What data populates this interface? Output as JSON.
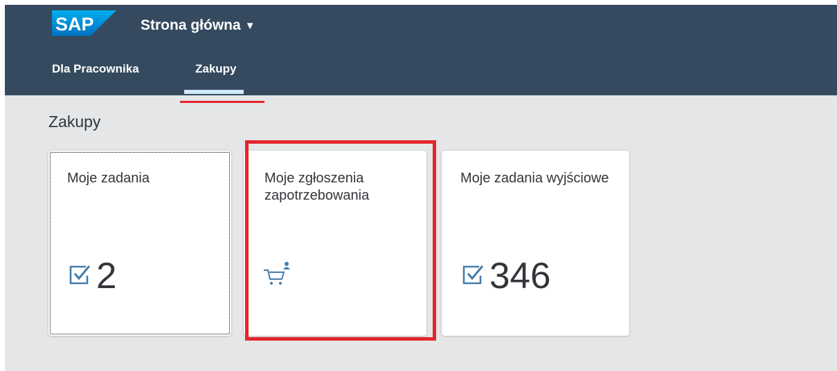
{
  "shell": {
    "logo_text": "SAP",
    "title": "Strona główna",
    "title_caret": "▼"
  },
  "tabs": [
    {
      "label": "Dla Pracownika"
    },
    {
      "label": "Zakupy",
      "selected": true
    }
  ],
  "section": {
    "title": "Zakupy"
  },
  "tiles": [
    {
      "title": "Moje zadania",
      "icon": "task-check-icon",
      "value": "2"
    },
    {
      "title": "Moje zgłoszenia zapotrzebowania",
      "icon": "cart-user-icon"
    },
    {
      "title": "Moje zadania wyjściowe",
      "icon": "task-check-icon",
      "value": "346"
    }
  ],
  "colors": {
    "shell_bg": "#354a5f",
    "page_bg": "#e4e6e7",
    "icon_blue": "#427cac",
    "highlight_red": "#e3262c"
  }
}
